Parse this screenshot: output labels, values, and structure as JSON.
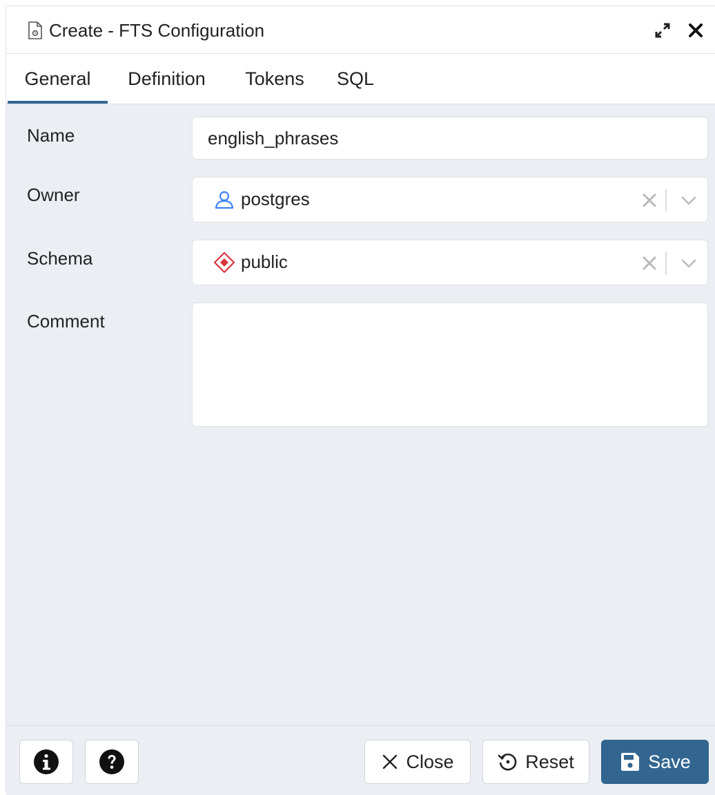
{
  "dialog": {
    "title": "Create - FTS Configuration",
    "icons": {
      "title": "fts-configuration-icon",
      "maximize": "maximize-icon",
      "close": "close-icon"
    }
  },
  "tabs": [
    {
      "label": "General",
      "active": true
    },
    {
      "label": "Definition",
      "active": false
    },
    {
      "label": "Tokens",
      "active": false
    },
    {
      "label": "SQL",
      "active": false
    }
  ],
  "form": {
    "name": {
      "label": "Name",
      "value": "english_phrases"
    },
    "owner": {
      "label": "Owner",
      "value": "postgres",
      "icon": "user-icon"
    },
    "schema": {
      "label": "Schema",
      "value": "public",
      "icon": "schema-icon"
    },
    "comment": {
      "label": "Comment",
      "value": ""
    }
  },
  "footer": {
    "info_icon": "info-icon",
    "help_icon": "help-icon",
    "close_label": "Close",
    "reset_label": "Reset",
    "save_label": "Save"
  },
  "colors": {
    "primary": "#326690",
    "background": "#ebeef3",
    "user_icon": "#3b82f6",
    "schema_icon": "#d9363e"
  }
}
